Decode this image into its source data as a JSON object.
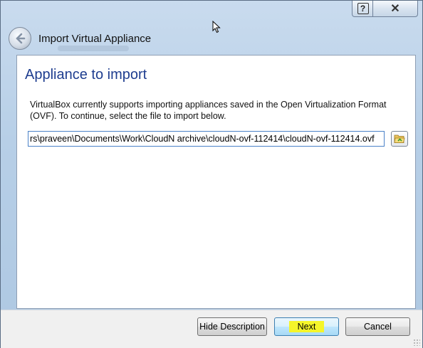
{
  "window": {
    "title": "Import Virtual Appliance",
    "help_glyph": "?",
    "close_glyph": "✕"
  },
  "page": {
    "heading": "Appliance to import",
    "description": "VirtualBox currently supports importing appliances saved in the Open Virtualization Format (OVF). To continue, select the file to import below."
  },
  "file_input": {
    "value": "rs\\praveen\\Documents\\Work\\CloudN archive\\cloudN-ovf-112414\\cloudN-ovf-112414.ovf"
  },
  "buttons": {
    "hide_description": "Hide Description",
    "next": "Next",
    "cancel": "Cancel"
  },
  "icons": {
    "back": "back-arrow-icon",
    "browse": "folder-open-icon",
    "help": "help-icon",
    "close": "close-icon"
  },
  "colors": {
    "heading": "#1e3d8f",
    "next_highlight": "#f5f52a",
    "input_border": "#4b82c8"
  }
}
